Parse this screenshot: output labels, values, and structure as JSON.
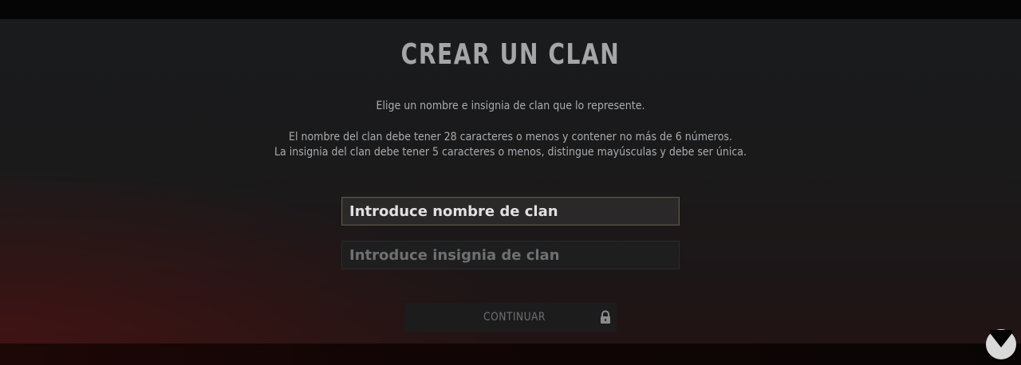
{
  "header": {
    "title": "CREAR UN CLAN"
  },
  "instructions": {
    "line1": "Elige un nombre e insignia de clan que lo represente.",
    "line2": "El nombre del clan debe tener 28 caracteres o menos y contener no más de 6 números.",
    "line3": "La insignia del clan debe tener 5 caracteres o menos, distingue mayúsculas y debe ser única."
  },
  "form": {
    "name_placeholder": "Introduce nombre de clan",
    "name_value": "",
    "tag_placeholder": "Introduce insignia de clan",
    "tag_value": ""
  },
  "actions": {
    "continue_label": "CONTINUAR",
    "continue_state": "locked",
    "continue_icon": "lock-icon"
  },
  "branding": {
    "corner_logo_icon": "vandal-logo-icon"
  },
  "colors": {
    "accent_border": "#5e5646",
    "text_primary": "#a9abad",
    "text_disabled": "#6d6e70"
  }
}
